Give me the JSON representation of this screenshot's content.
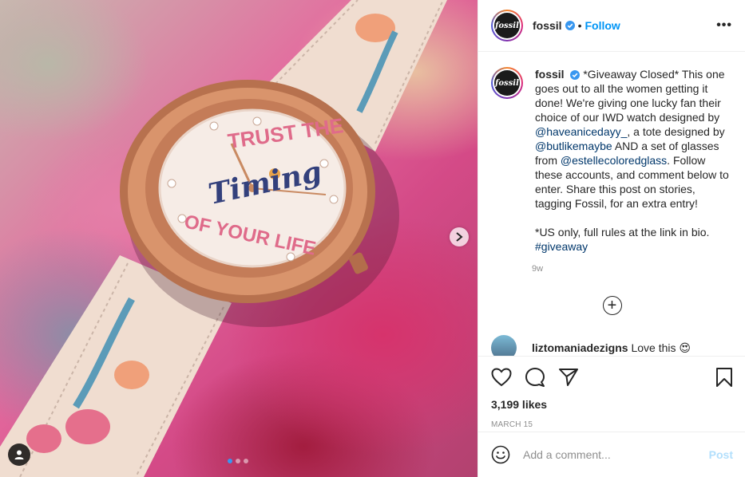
{
  "post": {
    "account": "fossil",
    "avatar_text": "fossil",
    "follow_label": "Follow",
    "separator": "•",
    "more_label": "•••"
  },
  "image": {
    "dial_line1": "TRUST THE",
    "dial_line2": "Timing",
    "dial_line3": "OF YOUR LIFE"
  },
  "caption": {
    "username": "fossil",
    "part1": "*Giveaway Closed* This one goes out to all the women getting it done! We're giving one lucky fan their choice of our IWD watch designed by ",
    "mention1": "@haveanicedayy_",
    "part2": ", a tote designed by ",
    "mention2": "@butlikemaybe",
    "part3": " AND a set of glasses from ",
    "mention3": "@estellecoloredglass",
    "part4": ". Follow these accounts, and comment below to enter. Share this post on stories, tagging Fossil, for an extra entry!",
    "part5": "*US only, full rules at the link in bio.",
    "hashtag": "#giveaway",
    "time": "9w"
  },
  "comment2": {
    "username": "liztomaniadezigns",
    "text": "Love this 😍"
  },
  "stats": {
    "likes": "3,199 likes",
    "date": "MARCH 15"
  },
  "add_comment": {
    "placeholder": "Add a comment...",
    "post_label": "Post"
  },
  "colors": {
    "accent": "#0095f6",
    "link": "#00376b",
    "muted": "#8e8e8e",
    "post_disabled": "#b2dffc"
  },
  "icons": [
    "verified-icon",
    "more-icon",
    "chevron-right-icon",
    "user-tag-icon",
    "plus-circle-icon",
    "heart-icon",
    "comment-icon",
    "share-icon",
    "bookmark-icon",
    "emoji-icon"
  ]
}
